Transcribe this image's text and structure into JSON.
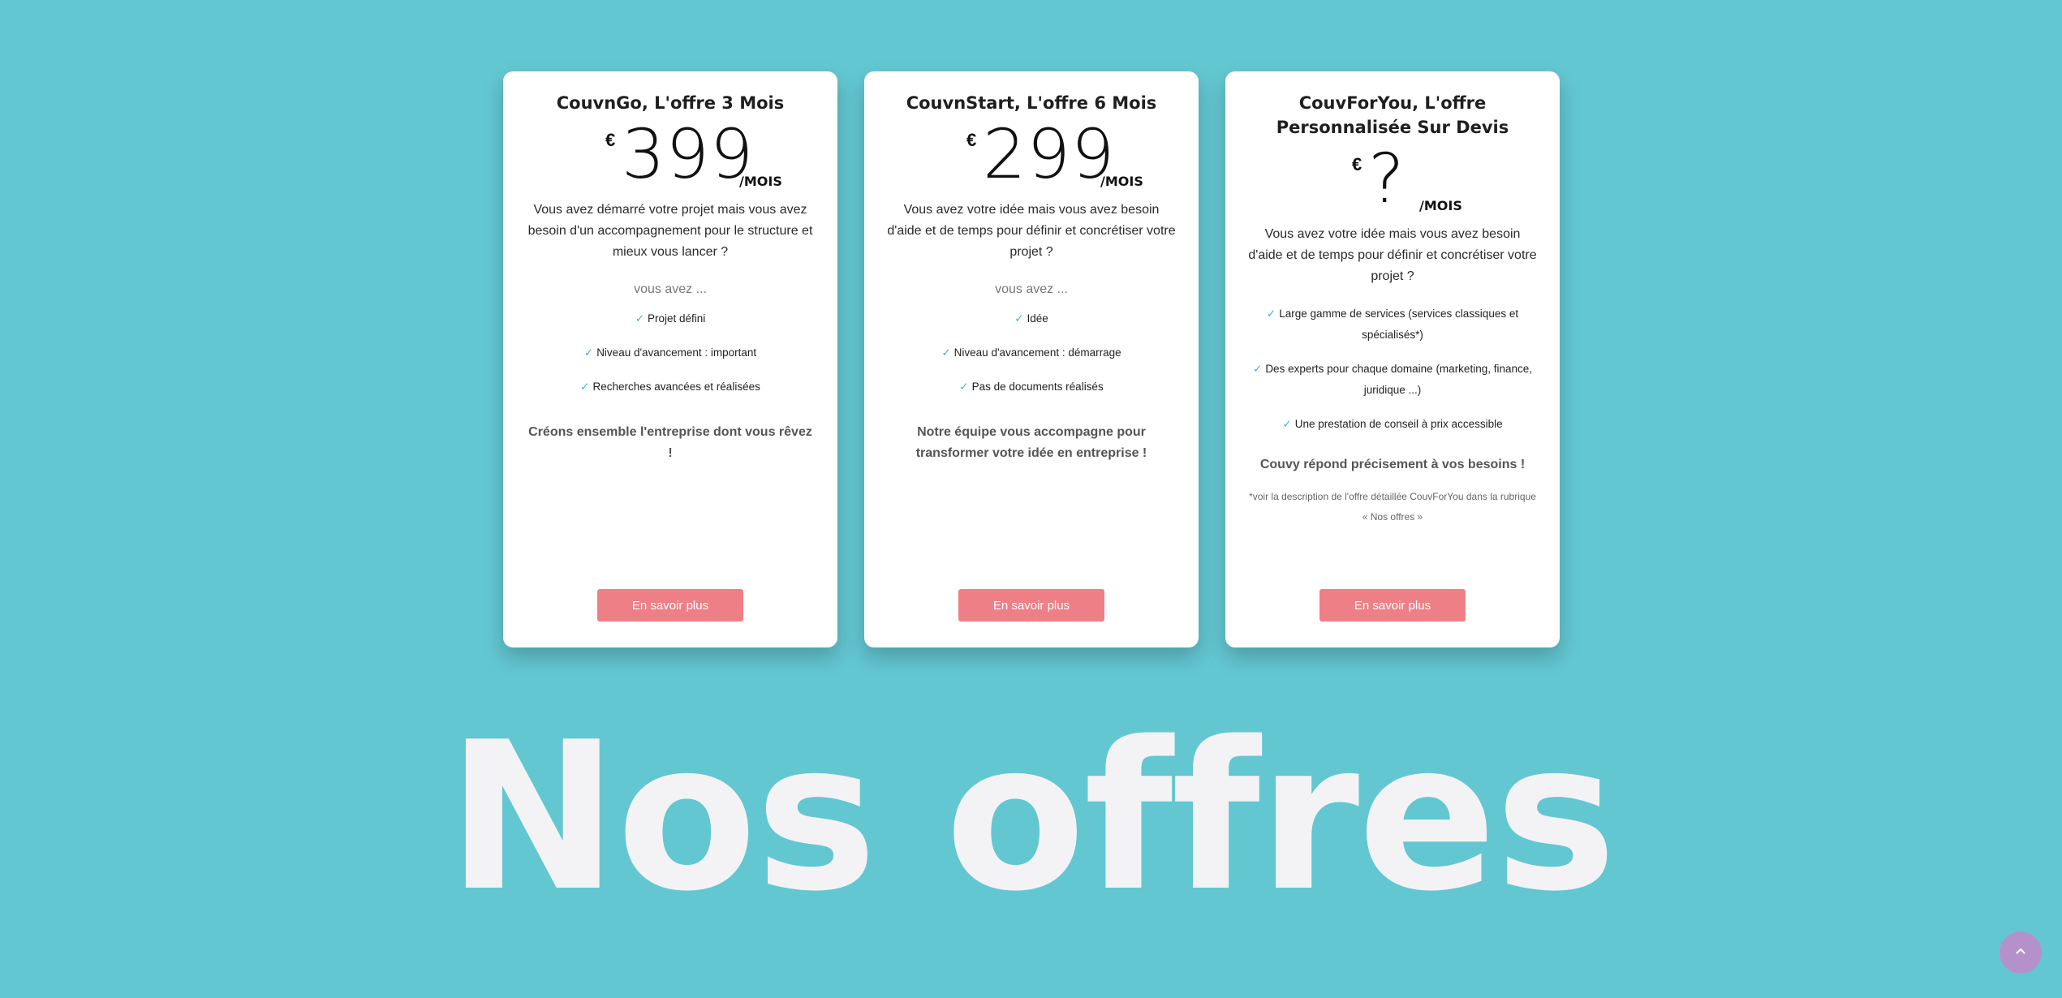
{
  "colors": {
    "background": "#63c7d2",
    "button": "#ef7f86",
    "check": "#3fb6c4",
    "hero_text": "#f3f3f6",
    "scroll_top": "#b492c9"
  },
  "cards": [
    {
      "title": "CouvnGo, L'offre 3 Mois",
      "currency": "€",
      "price": "399",
      "per": "/MOIS",
      "description": "Vous avez démarré votre projet mais vous avez besoin d'un accompagnement pour le structure et mieux vous lancer ?",
      "subheading": "vous avez ...",
      "features": [
        "Projet défini",
        "Niveau d'avancement : important",
        "Recherches avancées et réalisées"
      ],
      "tagline": "Créons ensemble l'entreprise dont vous rêvez !",
      "button": "En savoir plus"
    },
    {
      "title": "CouvnStart, L'offre 6 Mois",
      "currency": "€",
      "price": "299",
      "per": "/MOIS",
      "description": "Vous avez votre idée mais vous avez besoin d'aide et de temps pour définir et concrétiser votre projet ?",
      "subheading": "vous avez ...",
      "features": [
        "Idée",
        "Niveau d'avancement : démarrage",
        "Pas de documents réalisés"
      ],
      "tagline": "Notre équipe vous accompagne pour transformer votre idée en entreprise !",
      "button": "En savoir plus"
    },
    {
      "title": "CouvForYou, L'offre Personnalisée Sur Devis",
      "currency": "€",
      "price": "?",
      "per": "/MOIS",
      "description": "Vous avez votre idée mais vous avez besoin d'aide et de temps pour définir et concrétiser votre projet ?",
      "features": [
        "Large gamme de services (services classiques et spécialisés*)",
        "Des experts pour chaque domaine (marketing, finance, juridique ...)",
        "Une prestation de conseil à prix accessible"
      ],
      "tagline": "Couvy répond précisement à vos besoins !",
      "footnote": "*voir la description de l'offre détaillée CouvForYou dans la rubrique « Nos offres »",
      "button": "En savoir plus"
    }
  ],
  "check_glyph": "✓",
  "hero_title": "Nos offres",
  "scroll_top_icon": "chevron-up-icon"
}
